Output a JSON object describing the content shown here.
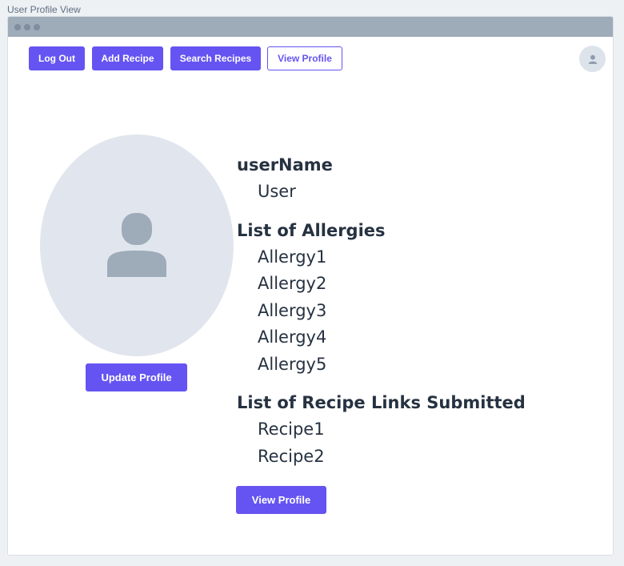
{
  "frame": {
    "label": "User Profile View"
  },
  "nav": {
    "logout_label": "Log Out",
    "add_recipe_label": "Add Recipe",
    "search_recipes_label": "Search Recipes",
    "view_profile_label": "View Profile"
  },
  "profile": {
    "update_button_label": "Update Profile",
    "username_heading": "userName",
    "username_value": "User",
    "allergies_heading": "List of Allergies",
    "allergies": [
      "Allergy1",
      "Allergy2",
      "Allergy3",
      "Allergy4",
      "Allergy5"
    ],
    "recipes_heading": "List of Recipe Links Submitted",
    "recipes": [
      "Recipe1",
      "Recipe2"
    ],
    "view_profile_button_label": "View Profile"
  },
  "icons": {
    "user_avatar": "user-icon",
    "profile_picture": "user-icon"
  },
  "colors": {
    "accent": "#6554f2",
    "titlebar": "#9eabb9",
    "avatar_bg": "#e1e6ee",
    "avatar_fg": "#9eabb9",
    "text": "#263241"
  }
}
